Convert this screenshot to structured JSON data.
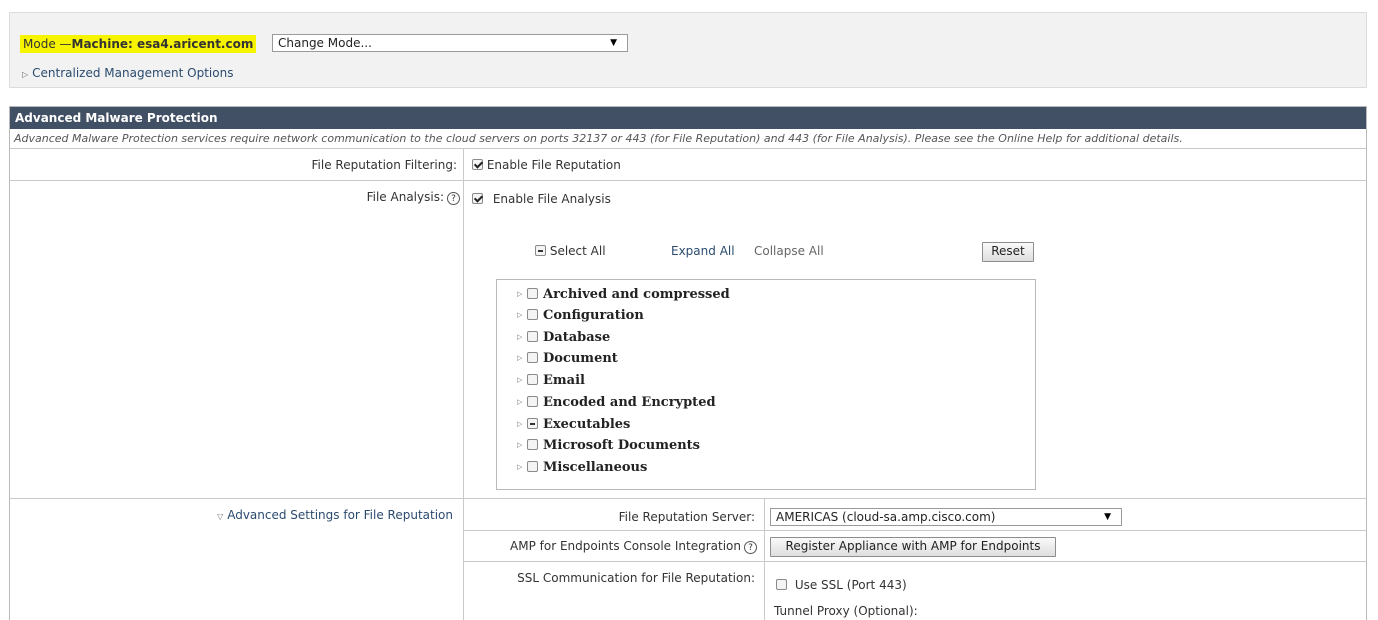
{
  "mode": {
    "prefix": "Mode —",
    "machine": "Machine: esa4.aricent.com",
    "change_mode": "Change Mode...",
    "centralized": "Centralized Management Options"
  },
  "panel": {
    "title": "Advanced Malware Protection",
    "description": "Advanced Malware Protection services require network communication to the cloud servers on ports 32137 or 443 (for File Reputation) and 443 (for File Analysis). Please see the Online Help for additional details."
  },
  "file_reputation": {
    "label": "File Reputation Filtering:",
    "checkbox_label": "Enable File Reputation",
    "checked": true
  },
  "file_analysis": {
    "label": "File Analysis:",
    "help": "?",
    "checkbox_label": "Enable File Analysis",
    "checked": true,
    "select_all": "Select All",
    "expand_all": "Expand All",
    "collapse_all": "Collapse All",
    "reset": "Reset",
    "file_types": [
      {
        "label": "Archived and compressed",
        "state": "unchecked"
      },
      {
        "label": "Configuration",
        "state": "unchecked"
      },
      {
        "label": "Database",
        "state": "unchecked"
      },
      {
        "label": "Document",
        "state": "unchecked"
      },
      {
        "label": "Email",
        "state": "unchecked"
      },
      {
        "label": "Encoded and Encrypted",
        "state": "unchecked"
      },
      {
        "label": "Executables",
        "state": "partial"
      },
      {
        "label": "Microsoft Documents",
        "state": "unchecked"
      },
      {
        "label": "Miscellaneous",
        "state": "unchecked"
      }
    ]
  },
  "advanced": {
    "toggle_label": "Advanced Settings for File Reputation",
    "server_label": "File Reputation Server:",
    "server_value": "AMERICAS (cloud-sa.amp.cisco.com)",
    "amp_label": "AMP for Endpoints Console Integration",
    "help": "?",
    "register_button": "Register Appliance with AMP for Endpoints",
    "ssl_label": "SSL Communication for File Reputation:",
    "use_ssl": "Use SSL (Port 443)",
    "tunnel_proxy": "Tunnel Proxy (Optional):"
  },
  "colors": {
    "header_bg": "#415064",
    "highlight": "#f7f400",
    "link": "#2b4b6f"
  }
}
